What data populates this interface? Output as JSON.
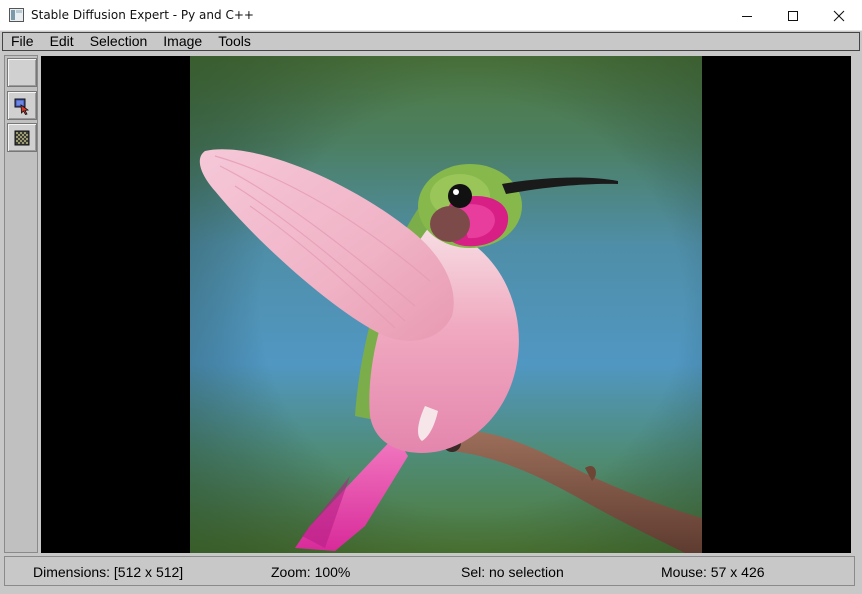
{
  "window": {
    "title": "Stable Diffusion Expert - Py and C++"
  },
  "menu": [
    "File",
    "Edit",
    "Selection",
    "Image",
    "Tools"
  ],
  "toolbar": {
    "tools": [
      "blank-tool",
      "select-pointer-tool",
      "checker-texture-tool"
    ]
  },
  "canvas": {
    "image": "hummingbird-on-branch"
  },
  "status": {
    "dimensions": "Dimensions: [512 x 512]",
    "zoom": "Zoom: 100%",
    "selection": "Sel: no selection",
    "mouse": "Mouse: 57 x 426"
  },
  "colors": {
    "chrome": "#c8c8c8",
    "canvas_bg": "#000000",
    "titlebar": "#ffffff"
  }
}
